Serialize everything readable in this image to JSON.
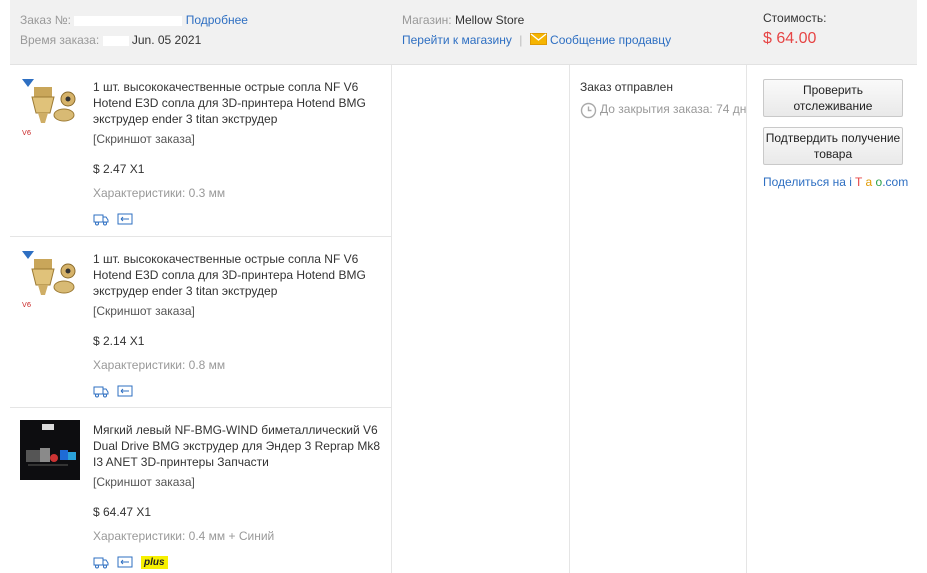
{
  "header": {
    "order_label": "Заказ №:",
    "details_link": "Подробнее",
    "time_label": "Время заказа:",
    "time_value": "Jun. 05 2021",
    "store_label": "Магазин:",
    "store_name": "Mellow Store",
    "go_store_link": "Перейти к магазину",
    "separator": "|",
    "message_link": "Сообщение продавцу",
    "cost_label": "Стоимость:",
    "cost_value": "$ 64.00"
  },
  "items": [
    {
      "title": "1 шт. высококачественные острые сопла NF V6 Hotend E3D сопла для 3D-принтера Hotend BMG экструдер ender 3 titan экструдер",
      "snapshot": "[Скриншот заказа]",
      "price": "$ 2.47 X1",
      "spec": "Характеристики: 0.3 мм"
    },
    {
      "title": "1 шт. высококачественные острые сопла NF V6 Hotend E3D сопла для 3D-принтера Hotend BMG экструдер ender 3 titan экструдер",
      "snapshot": "[Скриншот заказа]",
      "price": "$ 2.14 X1",
      "spec": "Характеристики: 0.8 мм"
    },
    {
      "title": "Мягкий левый NF-BMG-WIND биметаллический V6 Dual Drive BMG экструдер для Эндер 3 Reprap Mk8 I3 ANET 3D-принтеры Запчасти",
      "snapshot": "[Скриншот заказа]",
      "price": "$ 64.47 X1",
      "spec": "Характеристики: 0.4 мм + Синий",
      "badge": "plus"
    }
  ],
  "status": {
    "text": "Заказ отправлен",
    "countdown": "До закрытия заказа: 74 дн"
  },
  "actions": {
    "track_button": "Проверить отслеживание",
    "confirm_button": "Подтвердить получение товара",
    "share_prefix": "Поделиться на ",
    "share_i": "i",
    "share_t": "T",
    "share_a": "a",
    "share_o": "o",
    "share_com": ".com"
  },
  "colors": {
    "link": "#2e6fc2",
    "price": "#e64545",
    "header_bg": "#f1f1f1",
    "badge": "#f7f000"
  },
  "icons": [
    "shipping-truck-icon",
    "return-ticket-icon",
    "clock-icon",
    "envelope-icon"
  ]
}
